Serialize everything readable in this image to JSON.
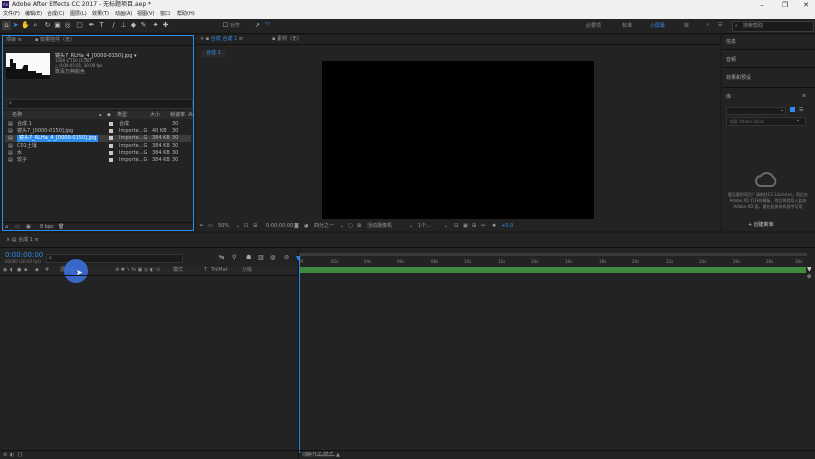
{
  "window": {
    "title": "Adobe After Effects CC 2017 - 无标题项目.aep *",
    "logo": "Ae"
  },
  "menu": [
    "文件(F)",
    "编辑(E)",
    "合成(C)",
    "图层(L)",
    "效果(T)",
    "动画(A)",
    "视图(V)",
    "窗口",
    "帮助(H)"
  ],
  "toolbar": {
    "snap_label": "对齐",
    "workspaces": [
      "必要项",
      "标准",
      "小屏幕",
      "库"
    ],
    "active_workspace": "小屏幕",
    "search_placeholder": "搜索帮助"
  },
  "project": {
    "tab_label": "项目",
    "effects_tab_label": "效果控件（无）",
    "preview_name": "镜头7_RLHa_4_[0000-0150].jpg ▾",
    "preview_info1": "1280 x 720 (1.00)",
    "preview_info2": "△ 0:00:05:01, 30.00 fps",
    "preview_info3": "数百万种颜色",
    "columns": {
      "name": "名称",
      "type": "类型",
      "size": "大小",
      "fps": "帧速率"
    },
    "items": [
      {
        "name": "合成 1",
        "type": "合成",
        "size": "",
        "fps": "30"
      },
      {
        "name": "镜头7_[0000-0150].jpg",
        "type": "Importe...G",
        "size": "40 KB",
        "fps": "30"
      },
      {
        "name": "镜头7_RLHa_4_[0000-0150].jpg",
        "type": "Importe...G",
        "size": "384 KB",
        "fps": "30"
      },
      {
        "name": "C01土壤",
        "type": "Importe...G",
        "size": "384 KB",
        "fps": "30"
      },
      {
        "name": "水",
        "type": "Importe...G",
        "size": "384 KB",
        "fps": "30"
      },
      {
        "name": "饺子",
        "type": "Importe...G",
        "size": "384 KB",
        "fps": "30"
      }
    ],
    "bpc": "8 bpc"
  },
  "composition": {
    "tab_label": "合成 合成 1",
    "footage_tab_label": "素材（无）",
    "breadcrumb": "合成 1",
    "zoom": "50%",
    "timecode": "0:00:00:00",
    "resolution": "四分之一",
    "camera": "活动摄像机",
    "views": "1个...",
    "exposure": "+0.0"
  },
  "right_panel": {
    "items": [
      "信息",
      "音频",
      "效果和预设"
    ],
    "library_label": "库",
    "library_search_placeholder": "搜索 Adobe Stock",
    "cc_message": "看见要的项目？请前往CC Libraries，然后在Adobe XD 打开的模板，然后将其导入此处 Adobe XD 面，要在此库发布面中可用",
    "create_library_button": "+ 创建新库"
  },
  "timeline": {
    "tab_label": "合成 1",
    "timecode": "0:00:00:00",
    "frame_info": "00000 (30.00 fps)",
    "columns": {
      "source_name": "源名称",
      "mode": "模式",
      "trkmat": "TrkMat",
      "parent": "父级"
    },
    "ruler": [
      "0f",
      "02s",
      "04s",
      "06s",
      "08s",
      "10s",
      "12s",
      "14s",
      "16s",
      "18s",
      "20s",
      "22s",
      "24s",
      "26s",
      "28s",
      "30s"
    ],
    "footer": "切换开关/模式"
  },
  "colors": {
    "accent": "#2d8ceb",
    "work_area": "#3f8a3f",
    "cursor": "#3b6fd9"
  }
}
